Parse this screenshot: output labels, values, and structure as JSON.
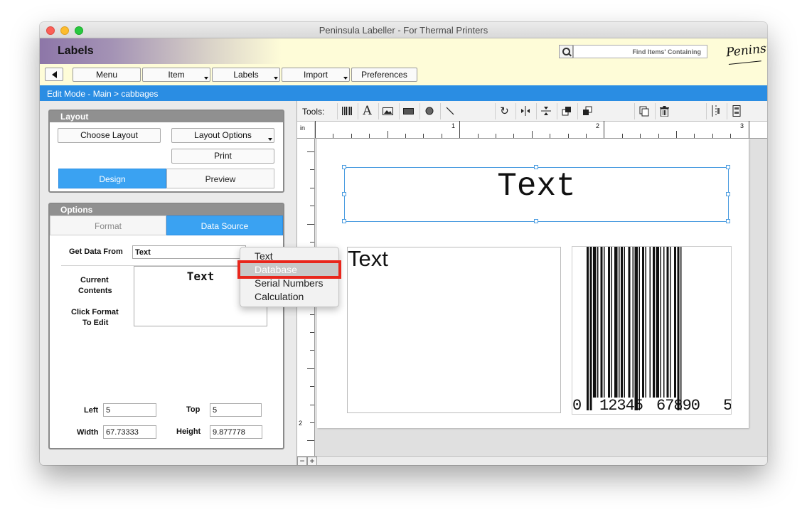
{
  "window": {
    "title": "Peninsula Labeller - For Thermal Printers"
  },
  "header": {
    "app_title": "Labels",
    "search_placeholder": "Find Items' Containing",
    "logo_text": "Peninsula"
  },
  "toolbar": {
    "menu": "Menu",
    "item": "Item",
    "labels": "Labels",
    "import": "Import",
    "preferences": "Preferences"
  },
  "breadcrumb": "Edit Mode - Main > cabbages",
  "layout_group": {
    "title": "Layout",
    "choose_layout": "Choose Layout",
    "layout_options": "Layout Options",
    "print": "Print",
    "design": "Design",
    "preview": "Preview"
  },
  "options_group": {
    "title": "Options",
    "format_tab": "Format",
    "data_source_tab": "Data Source",
    "get_data_from_label": "Get Data From",
    "get_data_from_value": "Text",
    "current_contents_label_1": "Current",
    "current_contents_label_2": "Contents",
    "click_format_label_1": "Click Format",
    "click_format_label_2": "To Edit",
    "current_contents_value": "Text",
    "left_label": "Left",
    "left_value": "5",
    "top_label": "Top",
    "top_value": "5",
    "width_label": "Width",
    "width_value": "67.73333",
    "height_label": "Height",
    "height_value": "9.877778"
  },
  "tools": {
    "label": "Tools:",
    "items": [
      "barcode-tool",
      "text-tool",
      "image-tool",
      "rectangle-tool",
      "ellipse-tool",
      "line-tool",
      "rotate-tool",
      "flip-horizontal-tool",
      "flip-vertical-tool",
      "bring-forward-tool",
      "send-backward-tool",
      "duplicate-tool",
      "delete-tool",
      "align-left-tool",
      "align-right-tool"
    ]
  },
  "ruler": {
    "unit": "in",
    "top_numbers": [
      "1",
      "2",
      "3"
    ],
    "left_numbers": [
      "2"
    ]
  },
  "canvas": {
    "big_text": "Text",
    "text2": "Text",
    "barcode_digits": {
      "first": "0",
      "middle_left": "12345",
      "middle_right": "67890",
      "last": "5"
    }
  },
  "dropdown": {
    "items": [
      "Text",
      "Database",
      "Serial Numbers",
      "Calculation"
    ],
    "highlighted": "Database"
  },
  "zoom": {
    "minus": "−",
    "plus": "+"
  }
}
